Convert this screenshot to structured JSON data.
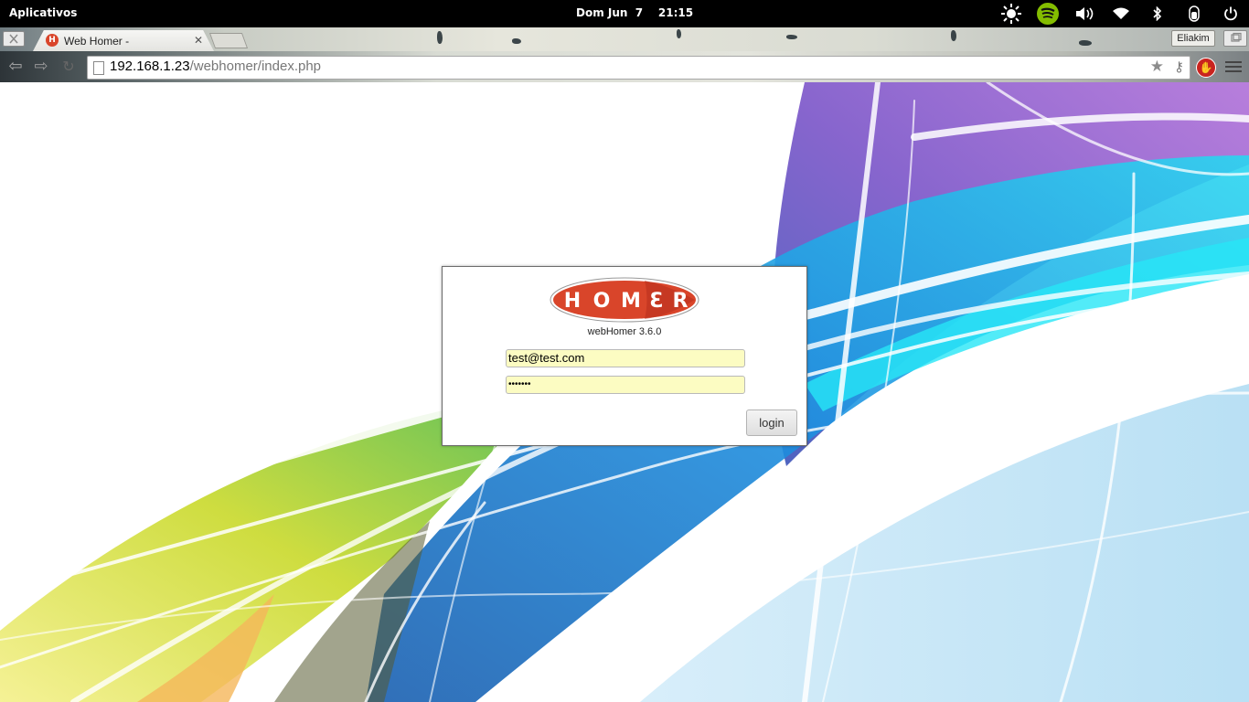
{
  "topbar": {
    "apps_label": "Aplicativos",
    "date": "Dom Jun  7",
    "time": "21:15"
  },
  "tray_icons": [
    "brightness-icon",
    "spotify-icon",
    "volume-icon",
    "wifi-icon",
    "bluetooth-icon",
    "mouse-battery-icon",
    "power-icon"
  ],
  "browser": {
    "tab_title": "Web Homer -",
    "tab_favicon_letter": "H",
    "user_name": "Eliakim",
    "url_host": "192.168.1.23",
    "url_path": "/webhomer/index.php",
    "abp_symbol": "✋"
  },
  "login": {
    "logo_letters": [
      "H",
      "O",
      "M",
      "Ɛ",
      "R"
    ],
    "version": "webHomer 3.6.0",
    "email_value": "test@test.com",
    "password_value": "•••••••",
    "login_button": "login"
  },
  "colors": {
    "logo_red": "#d9452a",
    "field_bg": "#fcfcc2"
  }
}
